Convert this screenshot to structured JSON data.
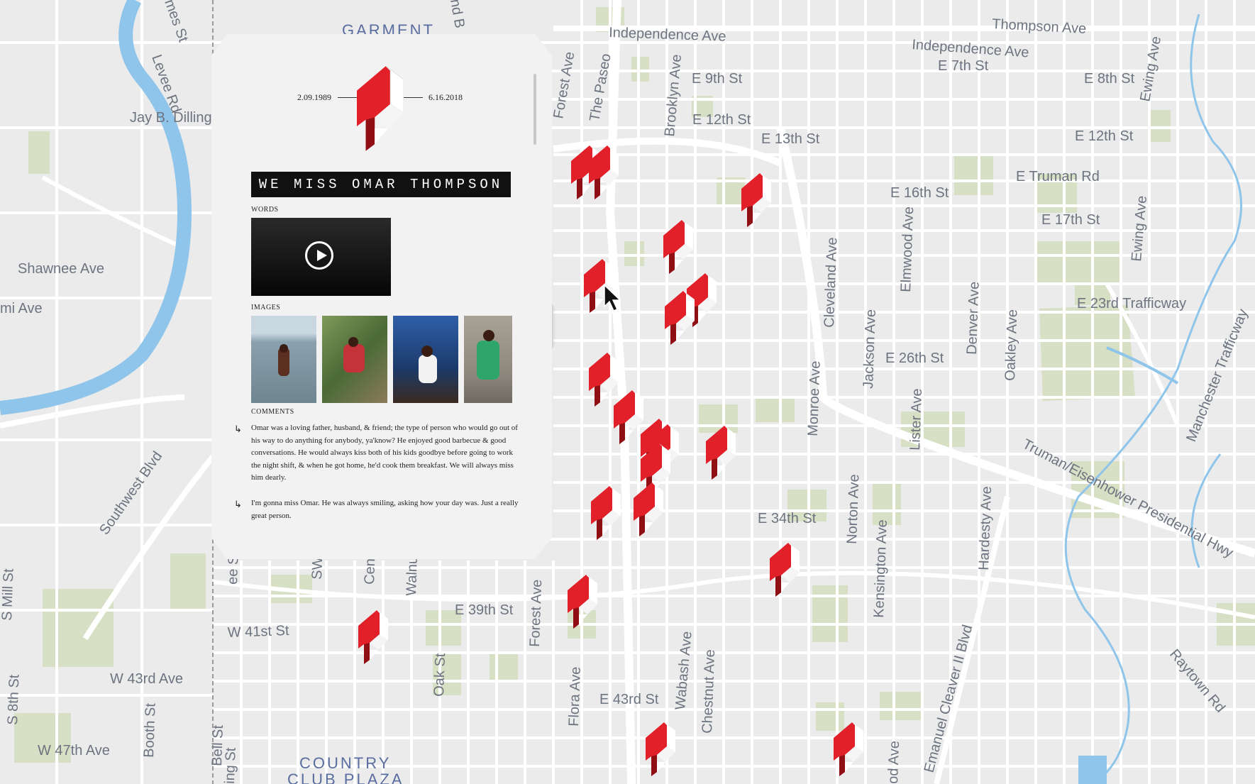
{
  "map": {
    "district_labels": [
      "GARMENT",
      "COUNTRY",
      "CLUB PLAZA"
    ],
    "streets": {
      "independence_ave_1": "Independence Ave",
      "independence_ave_2": "Independence Ave",
      "thompson_ave": "Thompson Ave",
      "e_7th_st": "E 7th St",
      "e_8th_st": "E 8th St",
      "e_9th_st": "E 9th St",
      "e_12th_st_1": "E 12th St",
      "e_12th_st_2": "E 12th St",
      "e_13th_st": "E 13th St",
      "e_truman_rd": "E Truman Rd",
      "e_16th_st": "E 16th St",
      "e_17th_st": "E 17th St",
      "e_23rd_trafficway": "E 23rd Trafficway",
      "e_26th_st": "E 26th St",
      "e_34th_st": "E 34th St",
      "e_39th_st": "E 39th St",
      "e_43rd_st": "E 43rd St",
      "w_41st_st": "W 41st St",
      "w_43rd_ave": "W 43rd Ave",
      "w_47th_ave": "W 47th Ave",
      "shawnee_ave": "Shawnee Ave",
      "mi_ave": "mi Ave",
      "jay_b_dilling": "Jay B. Dilling",
      "levee_rd": "Levee Rd",
      "james_st": "mes St",
      "southwest_blvd": "Southwest Blvd",
      "forest_ave_1": "Forest Ave",
      "forest_ave_2": "Forest Ave",
      "the_paseo": "The Paseo",
      "brooklyn_ave": "Brooklyn Ave",
      "cleveland_ave": "Cleveland Ave",
      "elmwood_ave": "Elmwood Ave",
      "denver_ave": "Denver Ave",
      "oakley_ave": "Oakley Ave",
      "jackson_ave": "Jackson Ave",
      "monroe_ave": "Monroe Ave",
      "lister_ave": "Lister Ave",
      "norton_ave": "Norton Ave",
      "kensington_ave": "Kensington Ave",
      "hardesty_ave": "Hardesty Ave",
      "emanuel_cleaver": "Emanuel Cleaver II Blvd",
      "ewing_ave_1": "Ewing Ave",
      "ewing_ave_2": "Ewing Ave",
      "manchester_trafficway": "Manchester Trafficway",
      "truman_eisenhower": "Truman/Eisenhower Presidential Hwy",
      "raytown_rd": "Raytown Rd",
      "wabash_ave": "Wabash Ave",
      "chestnut_ave": "Chestnut Ave",
      "flora_ave": "Flora Ave",
      "oak_st": "Oak St",
      "booth_st": "Booth St",
      "bell_st": "Bell St",
      "s_8th_st": "S 8th St",
      "s_mill_st": "S Mill St",
      "ee_st": "ee St",
      "sw": "SW",
      "cen": "Cen",
      "walnut": "Walnu",
      "ing_st": "ing St",
      "od_ave": "od Ave",
      "nd_b": "nd B"
    }
  },
  "memorial": {
    "born": "2.09.1989",
    "died": "6.16.2018",
    "name_banner": "WE MISS OMAR THOMPSON",
    "words_label": "WORDS",
    "images_label": "IMAGES",
    "comments_label": "COMMENTS",
    "comments": [
      "Omar was a loving father, husband, & friend; the type of person who would go out of his way to do anything for anybody, ya'know? He enjoyed good barbecue & good conversations. He would always kiss both of his kids goodbye before going to work the night shift, & when he got home, he'd cook them breakfast. We will always miss him dearly.",
      "I'm gonna miss Omar. He was always smiling, asking how your day was. Just a really great person."
    ]
  },
  "colors": {
    "map_bg": "#ebebeb",
    "road": "#ffffff",
    "park": "#d7dfc4",
    "water": "#8fc5ea",
    "marker_red": "#e1202a",
    "marker_dark": "#8f0f15"
  },
  "icons": [
    "memorial-marker-icon",
    "play-icon",
    "comment-arrow-icon",
    "cursor-icon"
  ]
}
